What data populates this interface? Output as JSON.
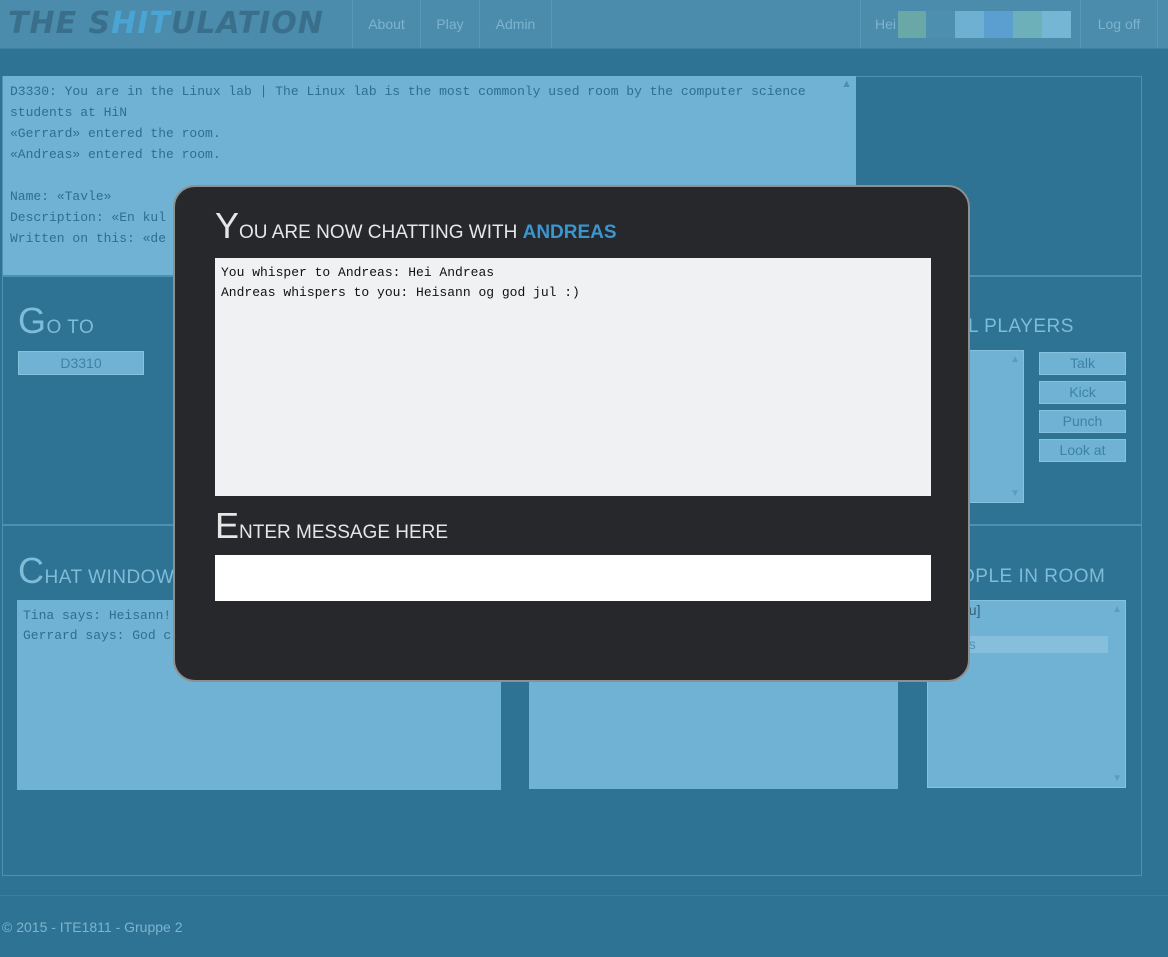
{
  "navbar": {
    "brand_pre": "THE S",
    "brand_mid": "HIT",
    "brand_post": "ULATION",
    "links": [
      "About",
      "Play",
      "Admin"
    ],
    "greeting": "Hei",
    "logoff": "Log off"
  },
  "room_log": {
    "lines": [
      "D3330: You are in the Linux lab | The Linux lab is the most commonly used room by the computer science",
      "students at HiN",
      "«Gerrard» entered the room.",
      "«Andreas» entered the room.",
      "",
      "Name: «Tavle»",
      "Description: «En kul",
      "Written on this: «de"
    ]
  },
  "goto": {
    "title_first": "G",
    "title_rest": "O TO",
    "rooms": [
      "D3310"
    ]
  },
  "players": {
    "title": "L PLAYERS",
    "actions": [
      "Talk",
      "Kick",
      "Punch",
      "Look at"
    ]
  },
  "chat_window": {
    "title_first": "C",
    "title_rest": "HAT WINDOW",
    "lines": [
      "Tina says: Heisann!",
      "Gerrard says: God c"
    ]
  },
  "people": {
    "title": "OPLE IN ROOM",
    "items": [
      "ou]",
      "d",
      "as"
    ]
  },
  "modal": {
    "title_first": "Y",
    "title_rest": "OU ARE NOW CHATTING WITH ",
    "partner": "ANDREAS",
    "messages": [
      "You whisper to Andreas: Hei Andreas",
      "Andreas whispers to you: Heisann og god jul :)"
    ],
    "input_title_first": "E",
    "input_title_rest": "NTER MESSAGE HERE",
    "input_value": ""
  },
  "footer": {
    "text": "© 2015 - ITE1811 - Gruppe 2"
  },
  "colors": {
    "background": "#2e7393",
    "panel": "#6fb2d4",
    "modal": "#26282c",
    "accent": "#3a96cf"
  }
}
